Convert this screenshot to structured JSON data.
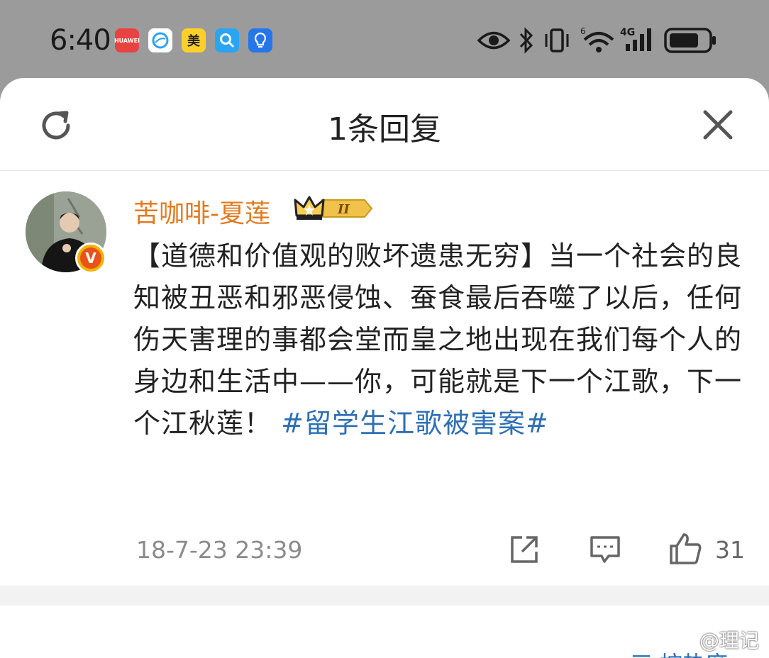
{
  "status_bar": {
    "time": "6:40",
    "apps": [
      {
        "name": "huawei-app-icon",
        "label": "HUAWEI",
        "color": "#e84343"
      },
      {
        "name": "browser-app-icon",
        "label": "",
        "color": "#ffffff"
      },
      {
        "name": "meituan-app-icon",
        "label": "美",
        "color": "#ffd02a"
      },
      {
        "name": "search-app-icon",
        "label": "",
        "color": "#2ba4f1"
      },
      {
        "name": "bulb-app-icon",
        "label": "",
        "color": "#2576e8"
      }
    ],
    "network_label": "4G",
    "signal_6": "6"
  },
  "header": {
    "title": "1条回复"
  },
  "comment": {
    "username": "苦咖啡-夏莲",
    "level_badge": "II",
    "verified_badge": "V",
    "text": "【道德和价值观的败坏遗患无穷】当一个社会的良知被丑恶和邪恶侵蚀、蚕食最后吞噬了以后，任何伤天害理的事都会堂而皇之地出现在我们每个人的身边和生活中——你，可能就是下一个江歌，下一个江秋莲！",
    "hashtag": "#留学生江歌被害案#",
    "timestamp": "18-7-23 23:39",
    "like_count": "31"
  },
  "footer": {
    "partial_text": "三 按热度",
    "watermark": "@理记"
  },
  "colors": {
    "accent_orange": "#e37a1f",
    "link_blue": "#2e6fb4"
  }
}
